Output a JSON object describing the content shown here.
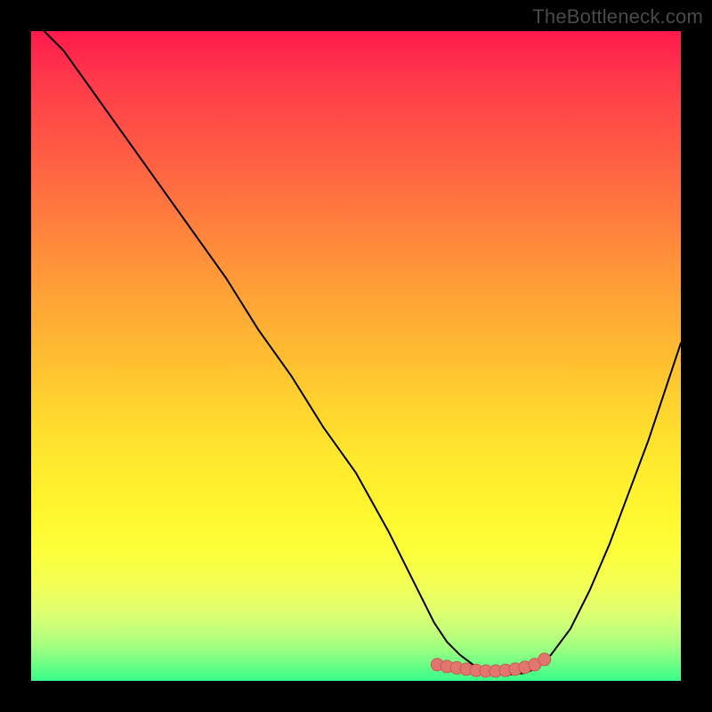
{
  "watermark": "TheBottleneck.com",
  "colors": {
    "background": "#000000",
    "curve_stroke": "#000000",
    "marker_fill": "#e2766e",
    "marker_stroke": "#c75a53"
  },
  "chart_data": {
    "type": "line",
    "title": "",
    "xlabel": "",
    "ylabel": "",
    "xlim": [
      0,
      100
    ],
    "ylim": [
      0,
      100
    ],
    "grid": false,
    "legend": false,
    "series": [
      {
        "name": "curve",
        "x": [
          2,
          5,
          10,
          15,
          20,
          25,
          30,
          35,
          40,
          45,
          50,
          55,
          58,
          60,
          62,
          64,
          66,
          68,
          70,
          72,
          74,
          76,
          78,
          80,
          83,
          86,
          89,
          92,
          95,
          98,
          100
        ],
        "y": [
          100,
          97,
          90,
          83,
          76,
          69,
          62,
          54,
          47,
          39,
          32,
          23,
          17,
          13,
          9,
          6,
          4,
          2.5,
          1.5,
          1,
          1,
          1.2,
          2,
          4,
          8,
          14,
          21,
          29,
          37,
          46,
          52
        ]
      }
    ],
    "markers": {
      "name": "optimal-range",
      "x": [
        62.5,
        64,
        65.5,
        67,
        68.5,
        70,
        71.5,
        73,
        74.5,
        76,
        77.5,
        79
      ],
      "y": [
        2.5,
        2.2,
        2.0,
        1.8,
        1.6,
        1.5,
        1.5,
        1.6,
        1.8,
        2.1,
        2.5,
        3.3
      ]
    }
  }
}
